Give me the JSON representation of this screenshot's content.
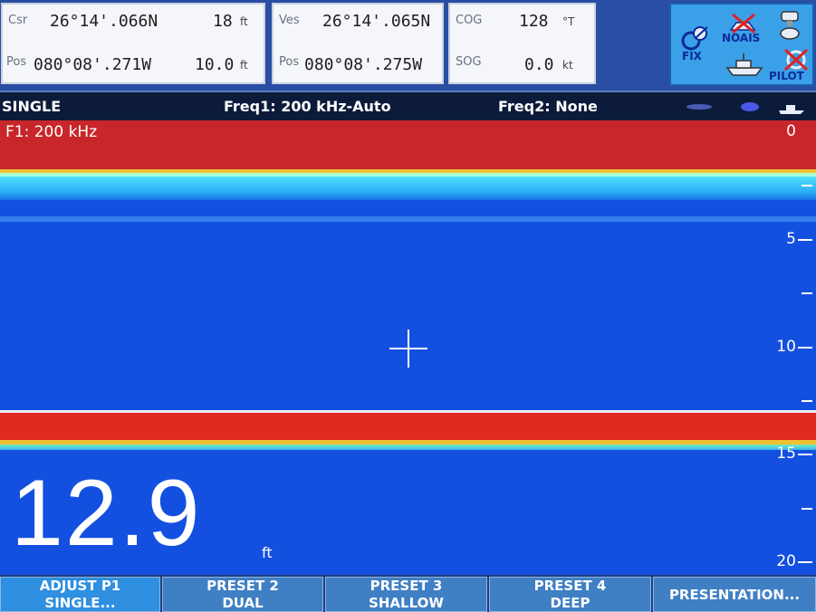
{
  "cursor_panel": {
    "csr_label": "Csr",
    "csr_lat": "26°14'.066N",
    "csr_range": "18",
    "csr_range_unit": "ft",
    "pos_label": "Pos",
    "pos_lon": "080°08'.271W",
    "pos_dist": "10.0",
    "pos_dist_unit": "ft"
  },
  "vessel_panel": {
    "ves_label": "Ves",
    "ves_lat": "26°14'.065N",
    "pos_label": "Pos",
    "pos_lon": "080°08'.275W"
  },
  "course_panel": {
    "cog_label": "COG",
    "cog_value": "128",
    "cog_unit": "°T",
    "sog_label": "SOG",
    "sog_value": "0.0",
    "sog_unit": "kt"
  },
  "status_icons": {
    "fix_label": "FIX",
    "noais_label": "NOAIS",
    "pilot_label": "PILOT"
  },
  "mode_bar": {
    "mode": "SINGLE",
    "freq1": "Freq1: 200 kHz-Auto",
    "freq2": "Freq2: None"
  },
  "sonar": {
    "channel_label": "F1: 200 kHz",
    "depth_range": [
      0,
      20
    ],
    "scale_labels": [
      "0",
      "5",
      "10",
      "15",
      "20"
    ],
    "depth_value": "12.9",
    "depth_unit": "ft",
    "colors": {
      "water": "#1450e0",
      "surface": "#c8262a",
      "bottom": "#e02a20",
      "surface_edge": "#4fe0ff"
    }
  },
  "softkeys": [
    {
      "line1": "ADJUST P1",
      "line2": "SINGLE..."
    },
    {
      "line1": "PRESET 2",
      "line2": "DUAL"
    },
    {
      "line1": "PRESET 3",
      "line2": "SHALLOW"
    },
    {
      "line1": "PRESET 4",
      "line2": "DEEP"
    },
    {
      "line1": "PRESENTATION...",
      "line2": ""
    }
  ]
}
